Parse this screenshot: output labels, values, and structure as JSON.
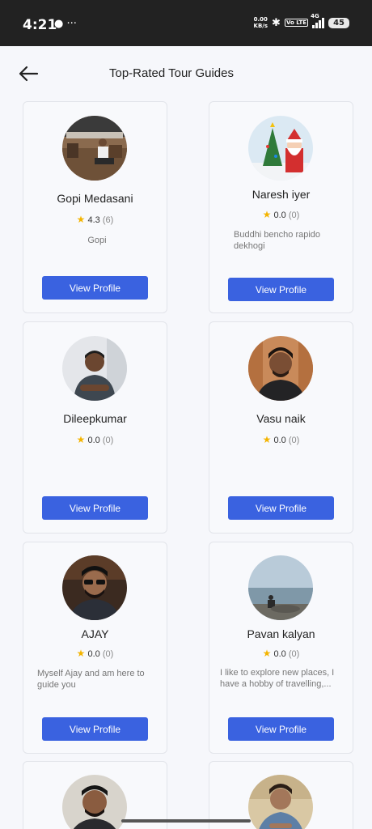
{
  "status": {
    "time": "4:21",
    "left_icons": "● ···",
    "speed_top": "0.00",
    "speed_bottom": "KB/s",
    "bluetooth": "✱",
    "volte": "Vo LTE",
    "network": "4G",
    "battery": "45"
  },
  "header": {
    "title": "Top-Rated Tour Guides",
    "back_icon": "arrow-left-icon"
  },
  "guides": [
    {
      "name": "Gopi Medasani",
      "rating": "4.3",
      "count": "(6)",
      "description": "Gopi",
      "button": "View Profile"
    },
    {
      "name": "Naresh iyer",
      "rating": "0.0",
      "count": "(0)",
      "description": "Buddhi bencho rapido dekhogi",
      "button": "View Profile"
    },
    {
      "name": "Dileepkumar",
      "rating": "0.0",
      "count": "(0)",
      "description": "",
      "button": "View Profile"
    },
    {
      "name": "Vasu naik",
      "rating": "0.0",
      "count": "(0)",
      "description": "",
      "button": "View Profile"
    },
    {
      "name": "AJAY",
      "rating": "0.0",
      "count": "(0)",
      "description": "Myself Ajay and am here to guide you",
      "button": "View Profile"
    },
    {
      "name": "Pavan kalyan",
      "rating": "0.0",
      "count": "(0)",
      "description": "I like to explore new places, I have a hobby of travelling,...",
      "button": "View Profile"
    }
  ],
  "colors": {
    "accent": "#3a62e0",
    "star": "#f4b400"
  }
}
